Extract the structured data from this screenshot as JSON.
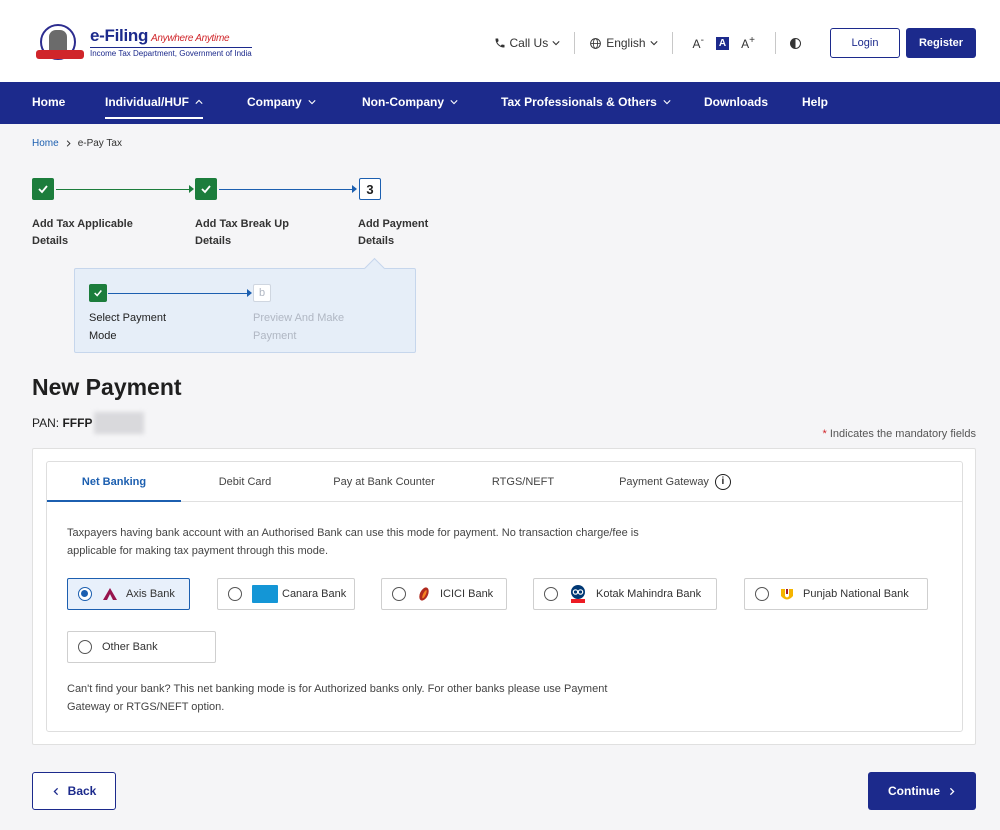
{
  "header": {
    "logo_title": "e-Filing",
    "logo_tagline": "Anywhere Anytime",
    "logo_subtitle": "Income Tax Department, Government of India",
    "call_us": "Call Us",
    "language": "English",
    "font_decrease": "A",
    "font_normal": "A",
    "font_increase": "A",
    "login_label": "Login",
    "register_label": "Register"
  },
  "nav": {
    "items": [
      {
        "label": "Home"
      },
      {
        "label": "Individual/HUF"
      },
      {
        "label": "Company"
      },
      {
        "label": "Non-Company"
      },
      {
        "label": "Tax Professionals & Others"
      },
      {
        "label": "Downloads"
      },
      {
        "label": "Help"
      }
    ]
  },
  "breadcrumb": {
    "home": "Home",
    "current": "e-Pay Tax"
  },
  "stepper": {
    "steps": [
      {
        "label": "Add Tax Applicable Details",
        "status": "done"
      },
      {
        "label": "Add Tax Break Up Details",
        "status": "done"
      },
      {
        "label": "Add Payment Details",
        "status": "current",
        "number": "3"
      }
    ],
    "substeps": [
      {
        "label": "Select Payment Mode",
        "status": "done"
      },
      {
        "label": "Preview And Make Payment",
        "status": "pending",
        "letter": "b"
      }
    ]
  },
  "page": {
    "title": "New Payment",
    "pan_label": "PAN:",
    "pan_value": "FFFP",
    "mandatory_note": "Indicates the mandatory fields",
    "mandatory_star": "*"
  },
  "payment_tabs": [
    {
      "label": "Net Banking",
      "active": true
    },
    {
      "label": "Debit Card",
      "active": false
    },
    {
      "label": "Pay at Bank Counter",
      "active": false
    },
    {
      "label": "RTGS/NEFT",
      "active": false
    },
    {
      "label": "Payment Gateway",
      "active": false
    }
  ],
  "net_banking": {
    "description": "Taxpayers having bank account with an Authorised Bank can use this mode for payment. No transaction charge/fee is applicable for making tax payment through this mode.",
    "banks": [
      {
        "name": "Axis Bank",
        "selected": true
      },
      {
        "name": "Canara Bank",
        "selected": false
      },
      {
        "name": "ICICI Bank",
        "selected": false
      },
      {
        "name": "Kotak Mahindra Bank",
        "selected": false
      },
      {
        "name": "Punjab National Bank",
        "selected": false
      },
      {
        "name": "Other Bank",
        "selected": false
      }
    ],
    "note": "Can't find your bank? This net banking mode is for Authorized banks only. For other banks please use Payment Gateway or RTGS/NEFT option."
  },
  "actions": {
    "back_label": "Back",
    "continue_label": "Continue"
  },
  "colors": {
    "primary": "#1c2a8c",
    "link": "#1c5fb0",
    "success": "#1c7d3c",
    "danger": "#d0252a"
  }
}
